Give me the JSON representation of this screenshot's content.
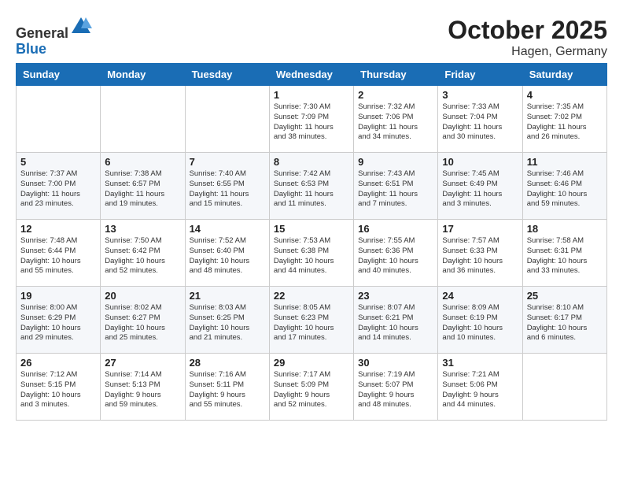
{
  "header": {
    "logo_line1": "General",
    "logo_line2": "Blue",
    "month": "October 2025",
    "location": "Hagen, Germany"
  },
  "days_of_week": [
    "Sunday",
    "Monday",
    "Tuesday",
    "Wednesday",
    "Thursday",
    "Friday",
    "Saturday"
  ],
  "weeks": [
    [
      {
        "day": "",
        "info": ""
      },
      {
        "day": "",
        "info": ""
      },
      {
        "day": "",
        "info": ""
      },
      {
        "day": "1",
        "info": "Sunrise: 7:30 AM\nSunset: 7:09 PM\nDaylight: 11 hours\nand 38 minutes."
      },
      {
        "day": "2",
        "info": "Sunrise: 7:32 AM\nSunset: 7:06 PM\nDaylight: 11 hours\nand 34 minutes."
      },
      {
        "day": "3",
        "info": "Sunrise: 7:33 AM\nSunset: 7:04 PM\nDaylight: 11 hours\nand 30 minutes."
      },
      {
        "day": "4",
        "info": "Sunrise: 7:35 AM\nSunset: 7:02 PM\nDaylight: 11 hours\nand 26 minutes."
      }
    ],
    [
      {
        "day": "5",
        "info": "Sunrise: 7:37 AM\nSunset: 7:00 PM\nDaylight: 11 hours\nand 23 minutes."
      },
      {
        "day": "6",
        "info": "Sunrise: 7:38 AM\nSunset: 6:57 PM\nDaylight: 11 hours\nand 19 minutes."
      },
      {
        "day": "7",
        "info": "Sunrise: 7:40 AM\nSunset: 6:55 PM\nDaylight: 11 hours\nand 15 minutes."
      },
      {
        "day": "8",
        "info": "Sunrise: 7:42 AM\nSunset: 6:53 PM\nDaylight: 11 hours\nand 11 minutes."
      },
      {
        "day": "9",
        "info": "Sunrise: 7:43 AM\nSunset: 6:51 PM\nDaylight: 11 hours\nand 7 minutes."
      },
      {
        "day": "10",
        "info": "Sunrise: 7:45 AM\nSunset: 6:49 PM\nDaylight: 11 hours\nand 3 minutes."
      },
      {
        "day": "11",
        "info": "Sunrise: 7:46 AM\nSunset: 6:46 PM\nDaylight: 10 hours\nand 59 minutes."
      }
    ],
    [
      {
        "day": "12",
        "info": "Sunrise: 7:48 AM\nSunset: 6:44 PM\nDaylight: 10 hours\nand 55 minutes."
      },
      {
        "day": "13",
        "info": "Sunrise: 7:50 AM\nSunset: 6:42 PM\nDaylight: 10 hours\nand 52 minutes."
      },
      {
        "day": "14",
        "info": "Sunrise: 7:52 AM\nSunset: 6:40 PM\nDaylight: 10 hours\nand 48 minutes."
      },
      {
        "day": "15",
        "info": "Sunrise: 7:53 AM\nSunset: 6:38 PM\nDaylight: 10 hours\nand 44 minutes."
      },
      {
        "day": "16",
        "info": "Sunrise: 7:55 AM\nSunset: 6:36 PM\nDaylight: 10 hours\nand 40 minutes."
      },
      {
        "day": "17",
        "info": "Sunrise: 7:57 AM\nSunset: 6:33 PM\nDaylight: 10 hours\nand 36 minutes."
      },
      {
        "day": "18",
        "info": "Sunrise: 7:58 AM\nSunset: 6:31 PM\nDaylight: 10 hours\nand 33 minutes."
      }
    ],
    [
      {
        "day": "19",
        "info": "Sunrise: 8:00 AM\nSunset: 6:29 PM\nDaylight: 10 hours\nand 29 minutes."
      },
      {
        "day": "20",
        "info": "Sunrise: 8:02 AM\nSunset: 6:27 PM\nDaylight: 10 hours\nand 25 minutes."
      },
      {
        "day": "21",
        "info": "Sunrise: 8:03 AM\nSunset: 6:25 PM\nDaylight: 10 hours\nand 21 minutes."
      },
      {
        "day": "22",
        "info": "Sunrise: 8:05 AM\nSunset: 6:23 PM\nDaylight: 10 hours\nand 17 minutes."
      },
      {
        "day": "23",
        "info": "Sunrise: 8:07 AM\nSunset: 6:21 PM\nDaylight: 10 hours\nand 14 minutes."
      },
      {
        "day": "24",
        "info": "Sunrise: 8:09 AM\nSunset: 6:19 PM\nDaylight: 10 hours\nand 10 minutes."
      },
      {
        "day": "25",
        "info": "Sunrise: 8:10 AM\nSunset: 6:17 PM\nDaylight: 10 hours\nand 6 minutes."
      }
    ],
    [
      {
        "day": "26",
        "info": "Sunrise: 7:12 AM\nSunset: 5:15 PM\nDaylight: 10 hours\nand 3 minutes."
      },
      {
        "day": "27",
        "info": "Sunrise: 7:14 AM\nSunset: 5:13 PM\nDaylight: 9 hours\nand 59 minutes."
      },
      {
        "day": "28",
        "info": "Sunrise: 7:16 AM\nSunset: 5:11 PM\nDaylight: 9 hours\nand 55 minutes."
      },
      {
        "day": "29",
        "info": "Sunrise: 7:17 AM\nSunset: 5:09 PM\nDaylight: 9 hours\nand 52 minutes."
      },
      {
        "day": "30",
        "info": "Sunrise: 7:19 AM\nSunset: 5:07 PM\nDaylight: 9 hours\nand 48 minutes."
      },
      {
        "day": "31",
        "info": "Sunrise: 7:21 AM\nSunset: 5:06 PM\nDaylight: 9 hours\nand 44 minutes."
      },
      {
        "day": "",
        "info": ""
      }
    ]
  ]
}
